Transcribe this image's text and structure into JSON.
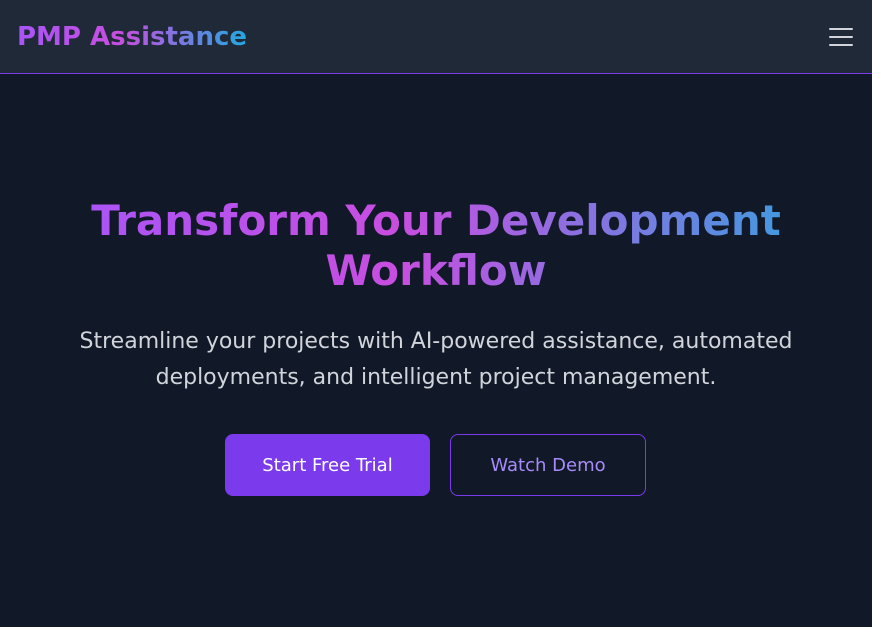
{
  "navbar": {
    "brand": "PMP Assistance",
    "menu_icon": "hamburger-menu-icon"
  },
  "hero": {
    "title": "Transform Your Development Workflow",
    "subtitle": "Streamline your projects with AI-powered assistance, automated deployments, and intelligent project management.",
    "primary_cta": "Start Free Trial",
    "secondary_cta": "Watch Demo"
  },
  "colors": {
    "background": "#111827",
    "navbar": "#1f2937",
    "accent": "#7c3aed",
    "gradient_start": "#a855f7",
    "gradient_end": "#3b9de0"
  }
}
